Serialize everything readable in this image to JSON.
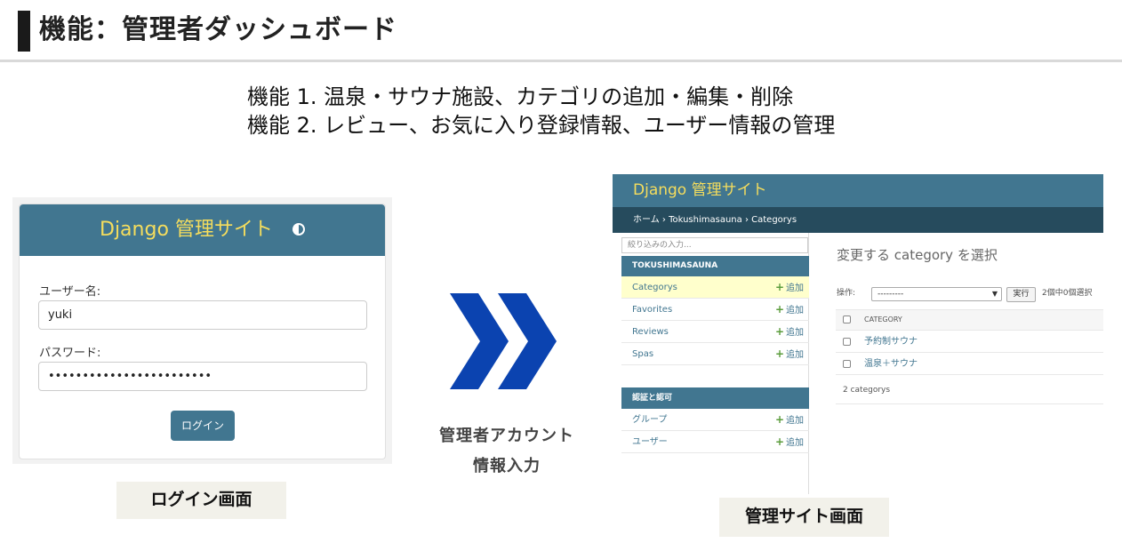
{
  "slide": {
    "title": "機能：管理者ダッシュボード",
    "feature_1": "機能 1. 温泉・サウナ施設、カテゴリの追加・編集・削除",
    "feature_2": "機能 2. レビュー、お気に入り登録情報、ユーザー情報の管理",
    "arrow_caption_line1": "管理者アカウント",
    "arrow_caption_line2": "情報入力",
    "login_caption": "ログイン画面",
    "admin_caption": "管理サイト画面"
  },
  "login": {
    "brand": "Django 管理サイト",
    "username_label": "ユーザー名:",
    "username_value": "yuki",
    "password_label": "パスワード:",
    "password_value": "••••••••••••••••••••••••",
    "submit_label": "ログイン"
  },
  "admin": {
    "brand": "Django 管理サイト",
    "breadcrumb_home": "ホーム",
    "breadcrumb_app": "Tokushimasauna",
    "breadcrumb_current": "Categorys",
    "breadcrumb_sep": "›",
    "filter_placeholder": "絞り込みの入力...",
    "app_caption": "TOKUSHIMASAUNA",
    "app_models": [
      {
        "name": "Categorys",
        "add": "追加"
      },
      {
        "name": "Favorites",
        "add": "追加"
      },
      {
        "name": "Reviews",
        "add": "追加"
      },
      {
        "name": "Spas",
        "add": "追加"
      }
    ],
    "auth_caption": "認証と認可",
    "auth_models": [
      {
        "name": "グループ",
        "add": "追加"
      },
      {
        "name": "ユーザー",
        "add": "追加"
      }
    ],
    "main_title": "変更する category を選択",
    "action_label": "操作:",
    "action_selected": "---------",
    "run_label": "実行",
    "selected_count": "2個中0個選択",
    "column_header": "CATEGORY",
    "rows": [
      "予約制サウナ",
      "温泉＋サウナ"
    ],
    "paginator": "2 categorys",
    "plus": "+"
  },
  "colors": {
    "admin_primary": "#417690",
    "admin_dark": "#264b5d",
    "brand_yellow": "#f5dd5d",
    "arrow_blue": "#0b43b0"
  }
}
